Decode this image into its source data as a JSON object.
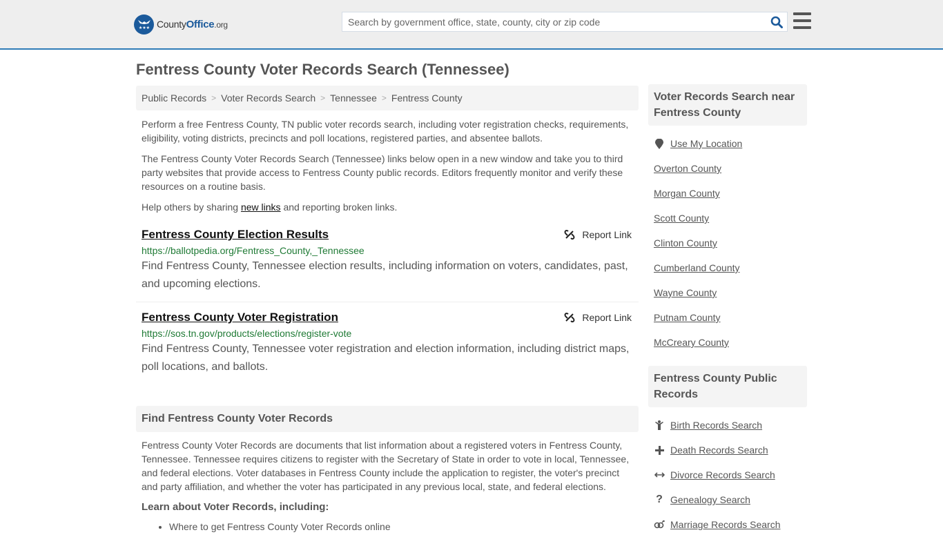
{
  "header": {
    "logo": {
      "county": "County",
      "office": "Office",
      "org": ".org"
    },
    "search": {
      "placeholder": "Search by government office, state, county, city or zip code",
      "value": ""
    },
    "search_icon": "search-icon",
    "menu_icon": "hamburger-menu-icon",
    "accent_color": "#2f7bb6"
  },
  "page_title": "Fentress County Voter Records Search (Tennessee)",
  "breadcrumb": [
    "Public Records",
    "Voter Records Search",
    "Tennessee",
    "Fentress County"
  ],
  "intro": {
    "p1": "Perform a free Fentress County, TN public voter records search, including voter registration checks, requirements, eligibility, voting districts, precincts and poll locations, registered parties, and absentee ballots.",
    "p2": "The Fentress County Voter Records Search (Tennessee) links below open in a new window and take you to third party websites that provide access to Fentress County public records. Editors frequently monitor and verify these resources on a routine basis.",
    "p3_before": "Help others by sharing ",
    "p3_link": "new links",
    "p3_after": " and reporting broken links."
  },
  "results": [
    {
      "title": "Fentress County Election Results",
      "url": "https://ballotpedia.org/Fentress_County,_Tennessee",
      "description": "Find Fentress County, Tennessee election results, including information on voters, candidates, past, and upcoming elections.",
      "report_label": "Report Link"
    },
    {
      "title": "Fentress County Voter Registration",
      "url": "https://sos.tn.gov/products/elections/register-vote",
      "description": "Find Fentress County, Tennessee voter registration and election information, including district maps, poll locations, and ballots.",
      "report_label": "Report Link"
    }
  ],
  "find_section": {
    "heading": "Find Fentress County Voter Records",
    "body": "Fentress County Voter Records are documents that list information about a registered voters in Fentress County, Tennessee. Tennessee requires citizens to register with the Secretary of State in order to vote in local, Tennessee, and federal elections. Voter databases in Fentress County include the application to register, the voter's precinct and party affiliation, and whether the voter has participated in any previous local, state, and federal elections.",
    "subheading": "Learn about Voter Records, including:",
    "bullets": [
      "Where to get Fentress County Voter Records online"
    ]
  },
  "sidebar": {
    "nearby": {
      "heading": "Voter Records Search near Fentress County",
      "use_location": "Use My Location",
      "counties": [
        "Overton County",
        "Morgan County",
        "Scott County",
        "Clinton County",
        "Cumberland County",
        "Wayne County",
        "Putnam County",
        "McCreary County"
      ]
    },
    "public_records": {
      "heading": "Fentress County Public Records",
      "items": [
        {
          "label": "Birth Records Search",
          "icon": "child-icon"
        },
        {
          "label": "Death Records Search",
          "icon": "cross-icon"
        },
        {
          "label": "Divorce Records Search",
          "icon": "arrows-horizontal-icon"
        },
        {
          "label": "Genealogy Search",
          "icon": "question-icon"
        },
        {
          "label": "Marriage Records Search",
          "icon": "marriage-icon"
        }
      ]
    }
  }
}
